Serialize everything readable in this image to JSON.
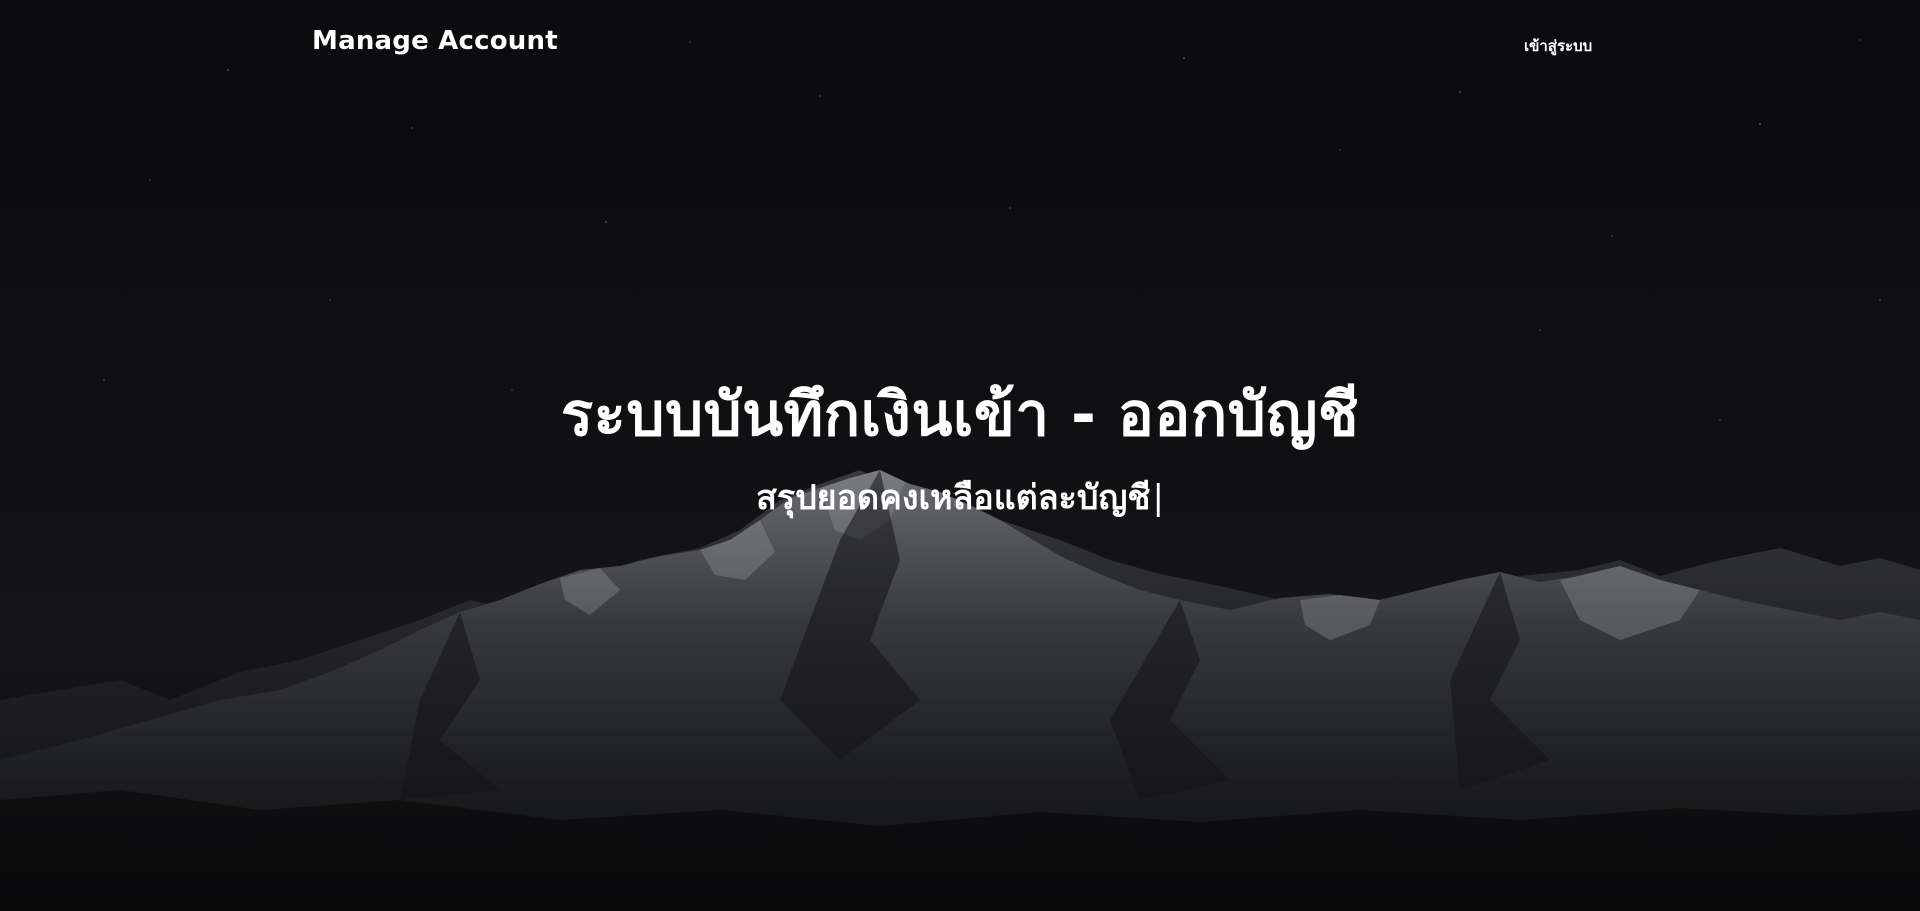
{
  "header": {
    "brand": "Manage Account",
    "login_link": "เข้าสู่ระบบ"
  },
  "hero": {
    "title": "ระบบบันทึกเงินเข้า - ออกบัญชี",
    "subtitle": "สรุปยอดคงเหลือแต่ละบัญชี",
    "cursor": "|"
  },
  "colors": {
    "text": "#ffffff",
    "background": "#121215"
  }
}
